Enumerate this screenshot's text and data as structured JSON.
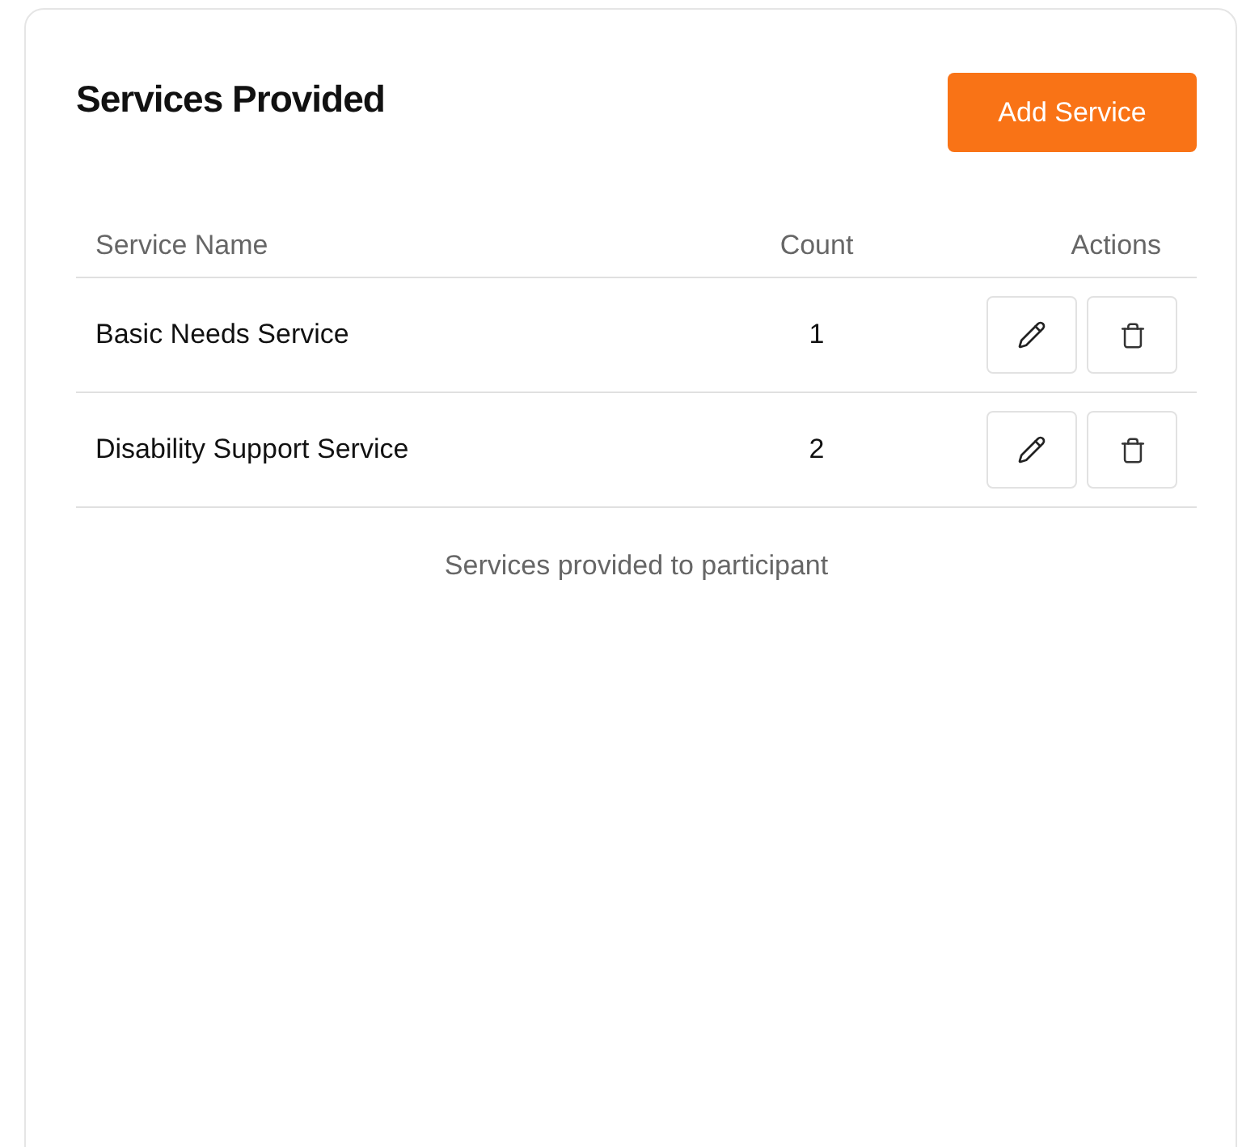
{
  "title": "Services Provided",
  "add_button": "Add Service",
  "table": {
    "columns": [
      "Service Name",
      "Count",
      "Actions"
    ],
    "rows": [
      {
        "name": "Basic Needs Service",
        "count": "1"
      },
      {
        "name": "Disability Support Service",
        "count": "2"
      }
    ]
  },
  "caption": "Services provided to participant"
}
